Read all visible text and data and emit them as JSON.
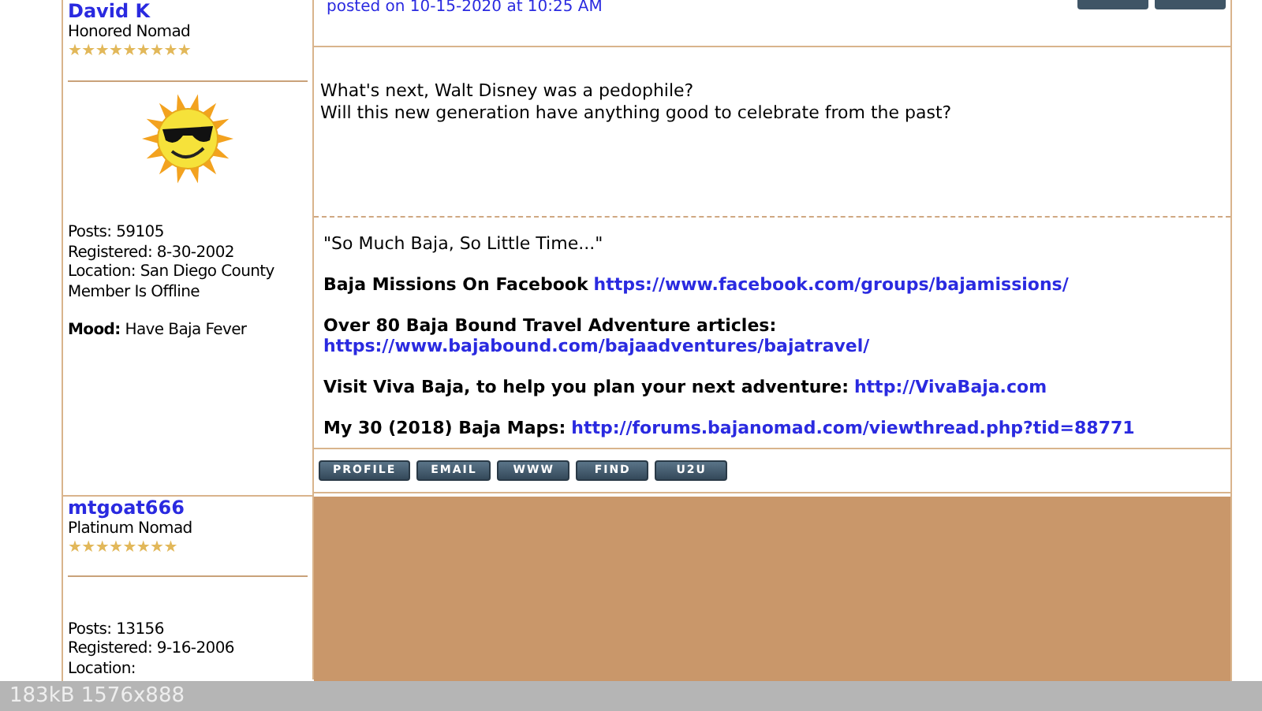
{
  "posts": [
    {
      "author": "David K",
      "rank": "Honored Nomad",
      "stars": 9,
      "avatar": {
        "kind": "sun"
      },
      "stats": [
        "Posts: 59105",
        "Registered: 8-30-2002",
        "Location: San Diego County",
        "Member Is Offline"
      ],
      "mood": "**Mood:** Have Baja Fever",
      "posted": "posted on 10-15-2020 at 10:25 AM",
      "message": [
        "What's next, Walt Disney was a pedophile?",
        "Will this new generation have anything good to celebrate from the past?"
      ],
      "signature": [
        {
          "kind": "quote",
          "text": "\"So Much Baja, So Little Time...\""
        },
        {
          "kind": "inline",
          "text": "Baja Missions On Facebook",
          "link": "https://www.facebook.com/groups/bajamissions/"
        },
        {
          "kind": "below",
          "text": "Over 80 Baja Bound Travel Adventure articles:",
          "link": "https://www.bajabound.com/bajaadventures/bajatravel/"
        },
        {
          "kind": "inline",
          "text": "Visit Viva Baja, to help you plan your next adventure:",
          "link": "http://VivaBaja.com"
        },
        {
          "kind": "inline",
          "text": "My 30 (2018) Baja Maps:",
          "link": "http://forums.bajanomad.com/viewthread.php?tid=88771"
        }
      ],
      "buttons": [
        "PROFILE",
        "EMAIL",
        "WWW",
        "FIND",
        "U2U"
      ]
    },
    {
      "author": "mtgoat666",
      "rank": "Platinum Nomad",
      "stars": 8,
      "stats": [
        "Posts: 13156",
        "Registered: 9-16-2006",
        "Location:"
      ]
    }
  ],
  "info_bar": "183kB 1576x888"
}
